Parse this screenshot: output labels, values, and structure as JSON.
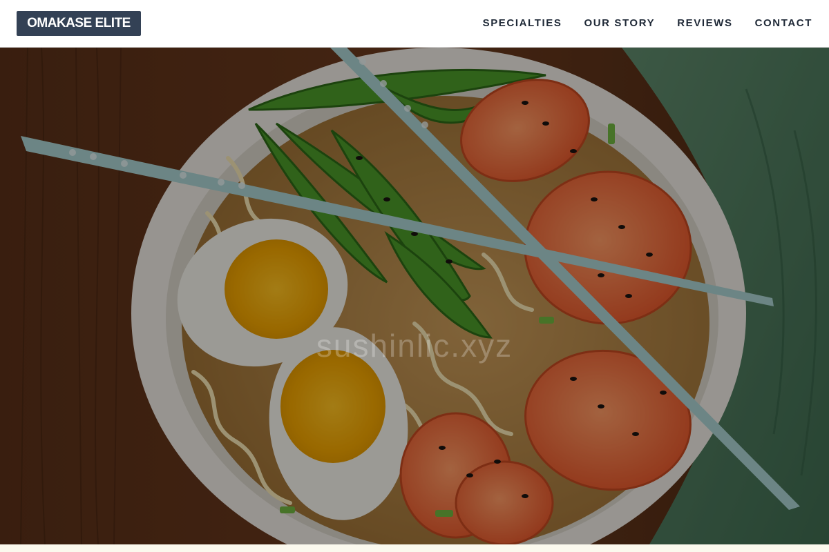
{
  "brand": {
    "name": "OMAKASE ELITE"
  },
  "nav": {
    "items": [
      {
        "label": "SPECIALTIES"
      },
      {
        "label": "OUR STORY"
      },
      {
        "label": "REVIEWS"
      },
      {
        "label": "CONTACT"
      }
    ]
  },
  "hero": {
    "heading": "sushinlic.xyz",
    "image_subject": "ramen bowl with soft-boiled eggs, shrimp, snap peas, noodles and chopsticks"
  },
  "colors": {
    "logo_background": "#334155",
    "nav_text": "#1f2937",
    "hero_overlay": "#000000"
  }
}
